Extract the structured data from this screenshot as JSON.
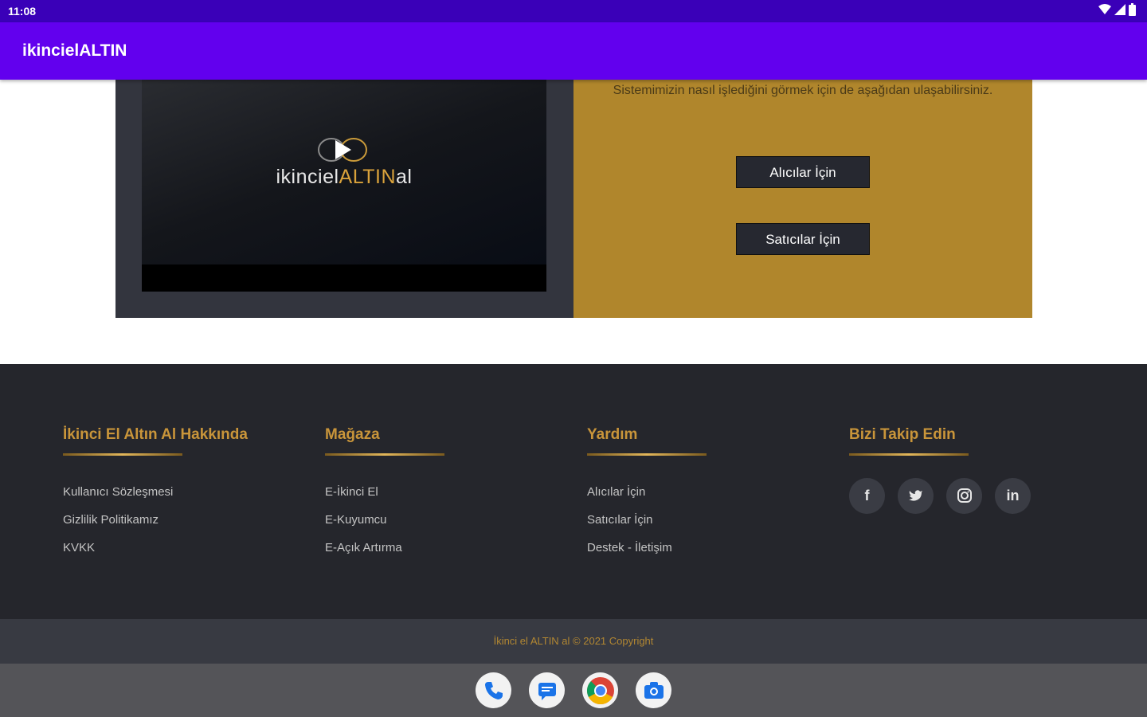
{
  "status_bar": {
    "time": "11:08"
  },
  "app_bar": {
    "title": "ikincielALTIN"
  },
  "hero": {
    "video_logo_prefix": "ikinciel",
    "video_logo_gold": "ALTIN",
    "video_logo_suffix": "al",
    "info_text": "Sistemimizin nasıl işlediğini görmek için de aşağıdan ulaşabilirsiniz.",
    "buyers_button": "Alıcılar İçin",
    "sellers_button": "Satıcılar İçin"
  },
  "footer": {
    "about": {
      "title": "İkinci El Altın Al Hakkında",
      "links": [
        "Kullanıcı Sözleşmesi",
        "Gizlilik Politikamız",
        "KVKK"
      ]
    },
    "store": {
      "title": "Mağaza",
      "links": [
        "E-İkinci El",
        "E-Kuyumcu",
        "E-Açık Artırma"
      ]
    },
    "help": {
      "title": "Yardım",
      "links": [
        "Alıcılar İçin",
        "Satıcılar İçin",
        "Destek - İletişim"
      ]
    },
    "follow": {
      "title": "Bizi Takip Edin",
      "icons": [
        "facebook-icon",
        "twitter-icon",
        "instagram-icon",
        "linkedin-icon"
      ]
    },
    "copyright": "İkinci el ALTIN al © 2021 Copyright"
  },
  "dock": {
    "apps": [
      "phone-icon",
      "messages-icon",
      "chrome-icon",
      "camera-icon"
    ]
  },
  "colors": {
    "accent_gold": "#b0862c",
    "app_bar": "#6200ee",
    "footer_bg": "#25262c"
  }
}
